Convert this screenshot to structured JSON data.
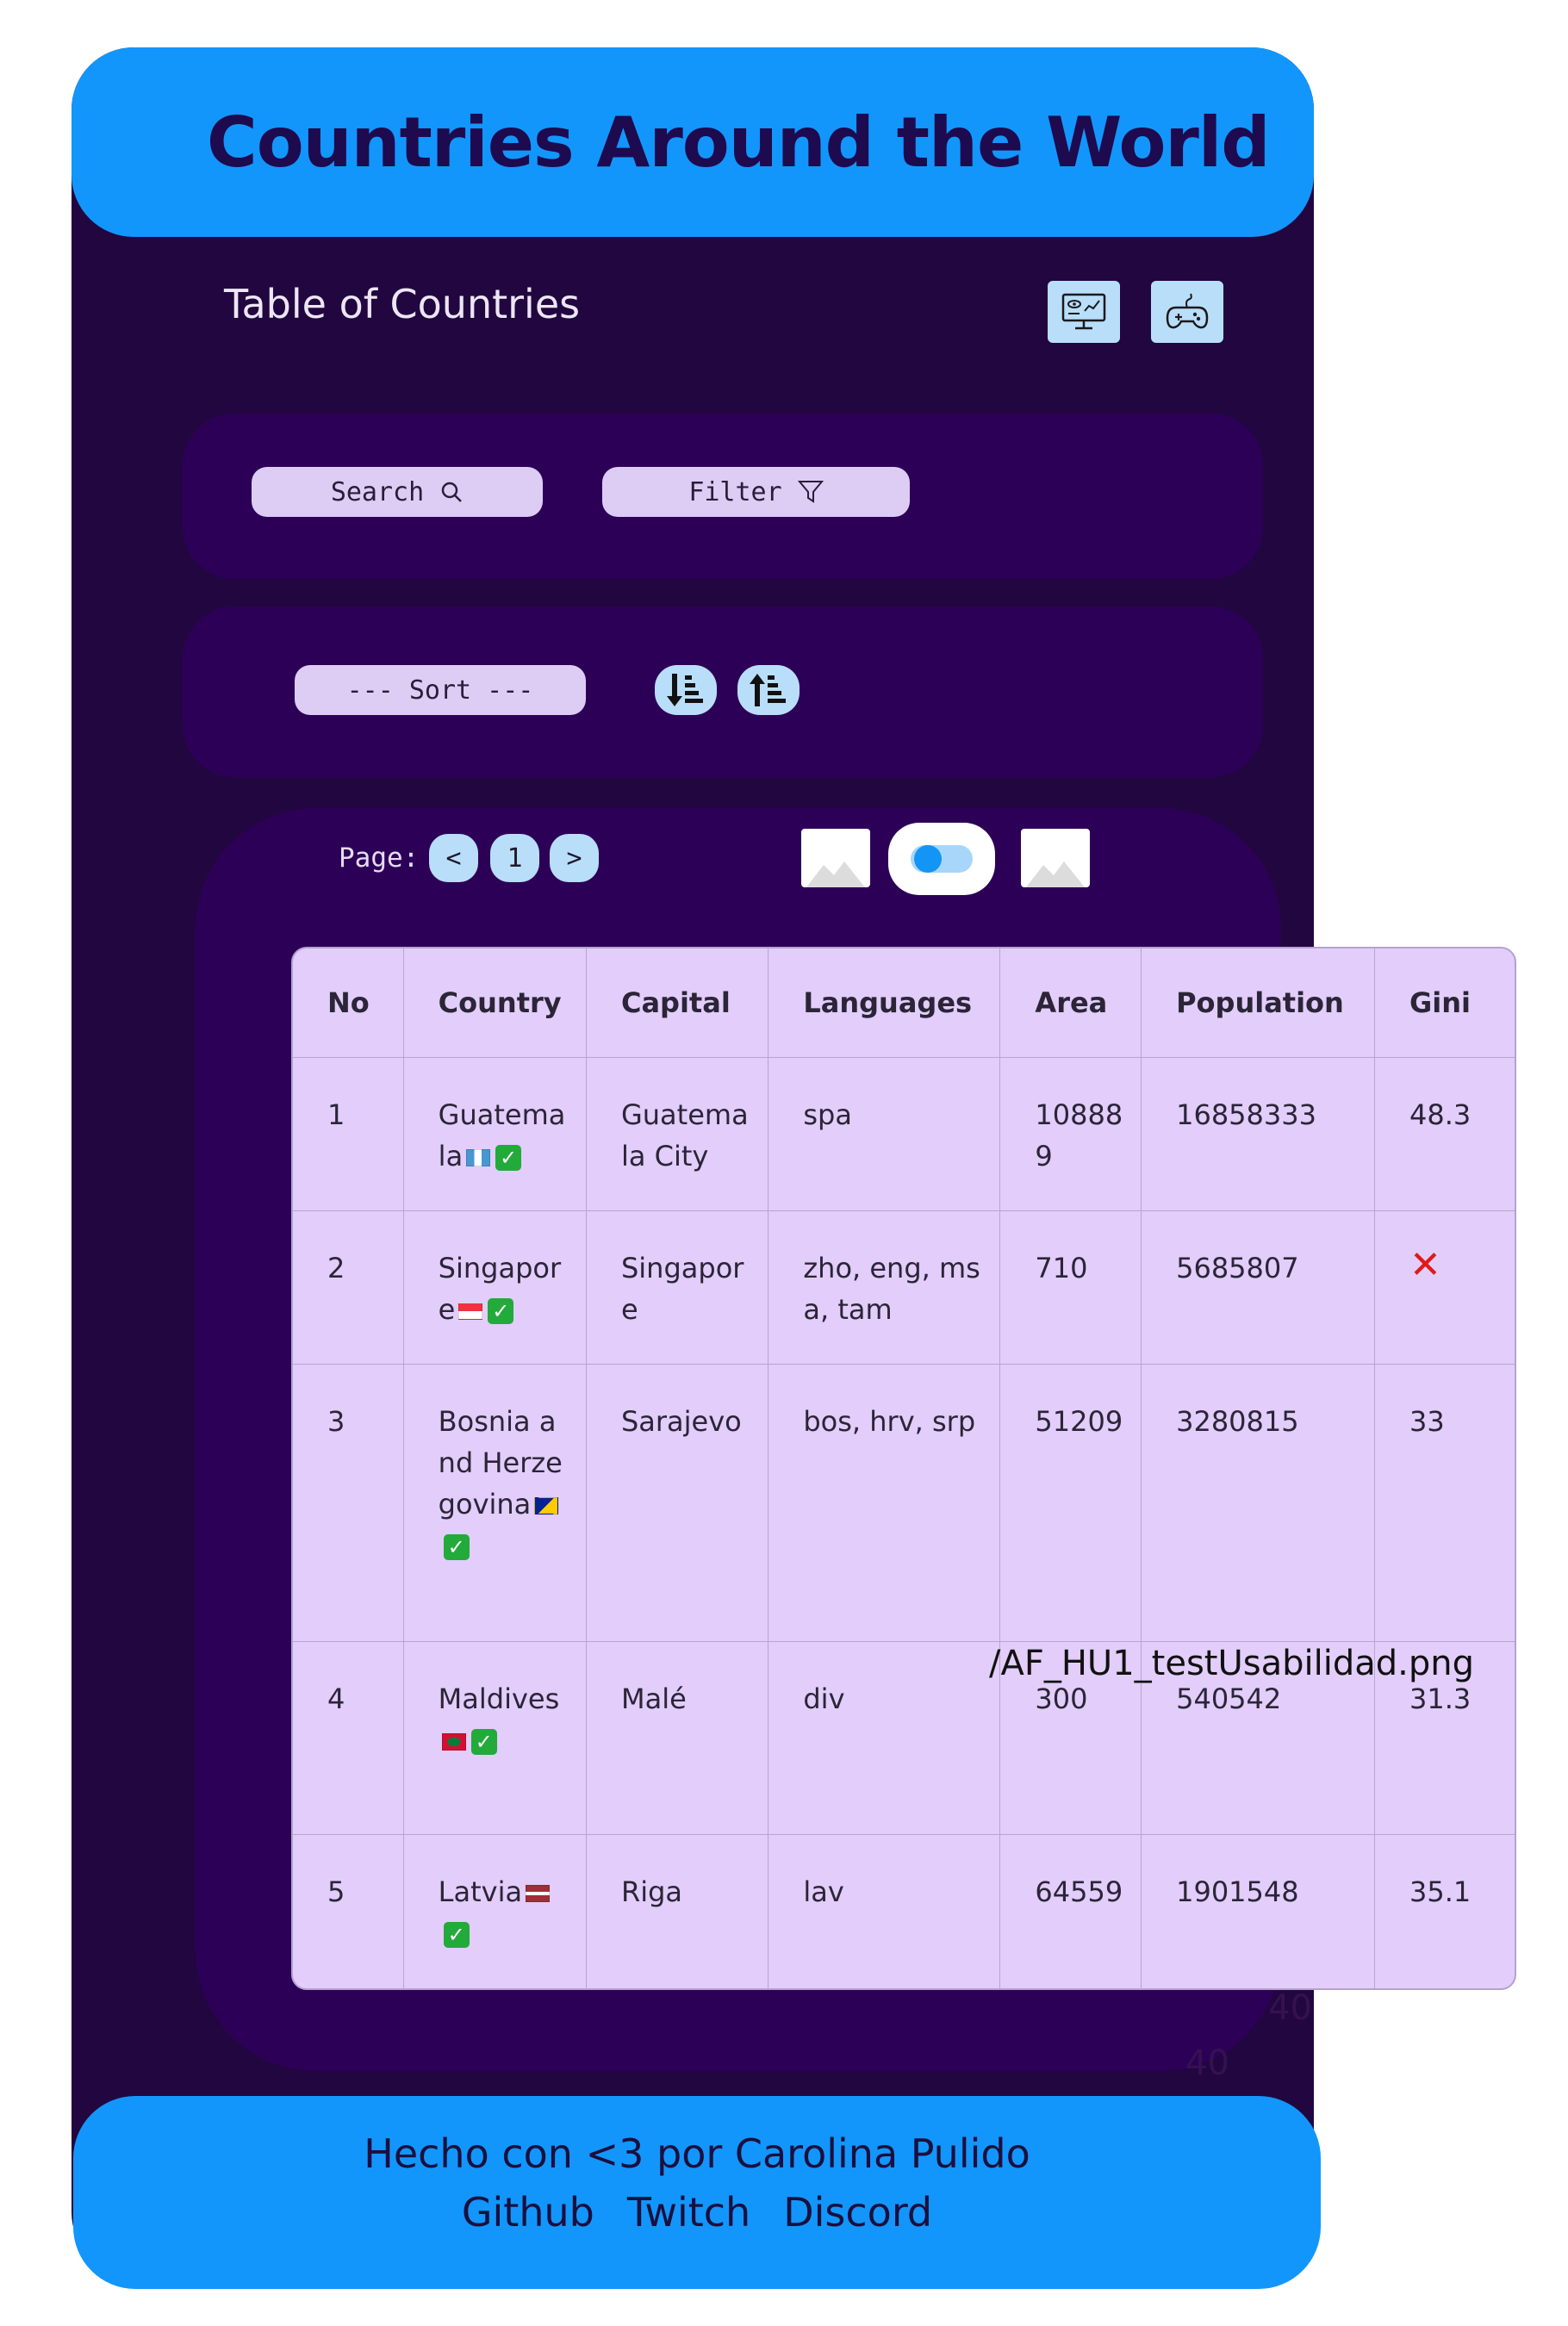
{
  "header": {
    "title": "Countries Around the World"
  },
  "subtitle": "Table of Countries",
  "toolbar": {
    "view_icon": "monitor-chart-icon",
    "game_icon": "gamepad-icon"
  },
  "search": {
    "label": "Search",
    "icon": "search-icon"
  },
  "filter": {
    "label": "Filter",
    "icon": "filter-icon"
  },
  "sort": {
    "label": "--- Sort ---",
    "desc_icon": "sort-descending-icon",
    "asc_icon": "sort-ascending-icon"
  },
  "pagination": {
    "label": "Page:",
    "prev": "<",
    "current": "1",
    "next": ">"
  },
  "table": {
    "headers": [
      "No",
      "Country",
      "Capital",
      "Languages",
      "Area",
      "Population",
      "Gini"
    ],
    "rows": [
      {
        "no": "1",
        "country": "Guatemala",
        "capital": "Guatemala City",
        "languages": "spa",
        "area": "108889",
        "population": "16858333",
        "gini": "48.3"
      },
      {
        "no": "2",
        "country": "Singapore",
        "capital": "Singapore",
        "languages": "zho, eng, msa, tam",
        "area": "710",
        "population": "5685807",
        "gini": ""
      },
      {
        "no": "3",
        "country": "Bosnia and Herzegovina",
        "capital": "Sarajevo",
        "languages": "bos, hrv, srp",
        "area": "51209",
        "population": "3280815",
        "gini": "33"
      },
      {
        "no": "4",
        "country": "Maldives",
        "capital": "Malé",
        "languages": "div",
        "area": "300",
        "population": "540542",
        "gini": "31.3"
      },
      {
        "no": "5",
        "country": "Latvia",
        "capital": "Riga",
        "languages": "lav",
        "area": "64559",
        "population": "1901548",
        "gini": "35.1"
      }
    ]
  },
  "overlay_path": "/AF_HU1_testUsabilidad.png",
  "ghost_numbers": [
    "40",
    "40"
  ],
  "footer": {
    "credit": "Hecho con <3 por Carolina Pulido",
    "links": [
      "Github",
      "Twitch",
      "Discord"
    ]
  },
  "colors": {
    "header_bg": "#1296fb",
    "app_bg": "#220640",
    "panel_bg": "#2d0058",
    "table_bg": "#e2cdfb",
    "button_bg": "#b9defa"
  }
}
